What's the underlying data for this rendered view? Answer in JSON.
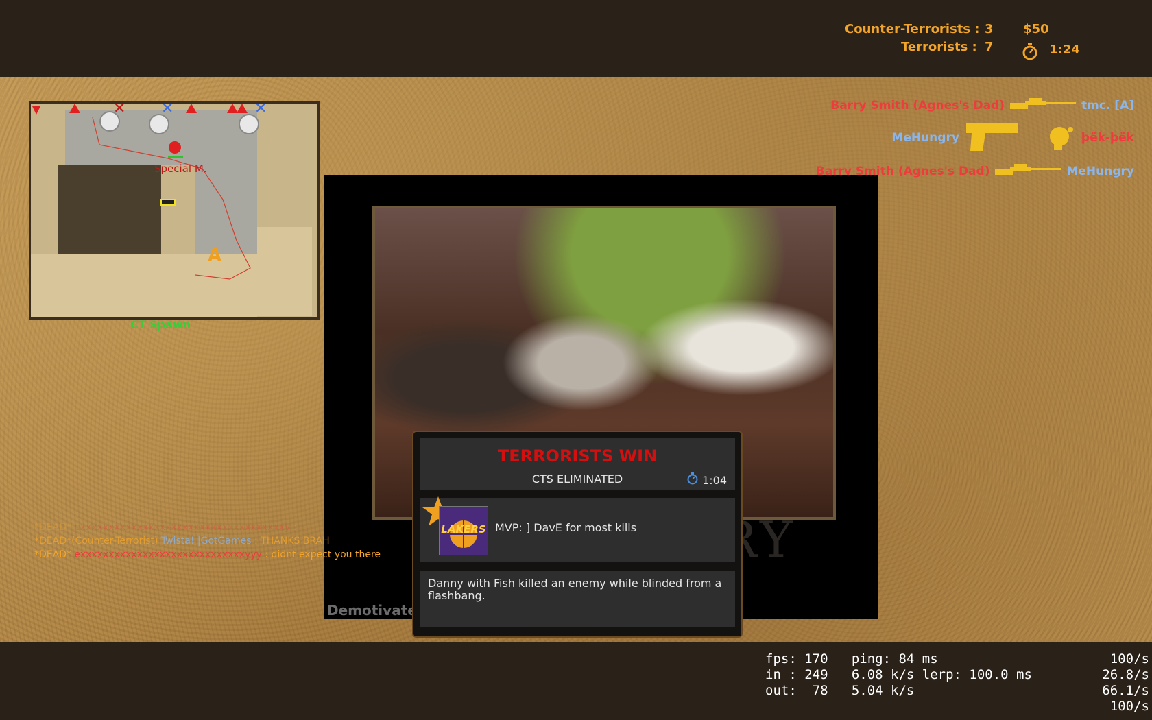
{
  "score": {
    "ct_label": "Counter-Terrorists :",
    "ct_score": "3",
    "t_label": "Terrorists :",
    "t_score": "7",
    "money": "$50",
    "timer": "1:24"
  },
  "killfeed": [
    {
      "killer": "Barry Smith (Agnes's Dad)",
      "killer_team": "t",
      "weapon": "sniper-rifle-icon",
      "victim": "tmc. [A]",
      "victim_team": "ct"
    },
    {
      "killer": "MeHungry",
      "killer_team": "ct",
      "weapon": "pistol-icon",
      "headshot": true,
      "victim": "þëk-þëk",
      "victim_team": "t"
    },
    {
      "killer": "Barry Smith (Agnes's Dad)",
      "killer_team": "t",
      "weapon": "sniper-rifle-icon",
      "victim": "MeHungry",
      "victim_team": "ct"
    }
  ],
  "minimap": {
    "location": "CT Spawn",
    "marker_label": "Special M.",
    "bombsite": "A"
  },
  "poster": {
    "watermark": "DemotivateUs.com",
    "caption": "BRAVERY"
  },
  "round_end": {
    "title": "TERRORISTS WIN",
    "reason": "CTS ELIMINATED",
    "time": "1:04",
    "mvp_text": "MVP: ] DavE for most kills",
    "mvp_avatar": "LAKERS",
    "award_text": "Danny with Fish killed an enemy while blinded from a flashbang."
  },
  "chat": [
    {
      "prefix": "*DEAD*",
      "name": "exxxxxxxxxxxxxxxxxxxxxxxxxxxxxxxxxxxxy",
      "message": ":",
      "faded": true
    },
    {
      "prefix": "*DEAD*(Counter-Terrorist)",
      "name": "Twista! |GotGames",
      "message": ":  THANKS BRAH",
      "faded": true
    },
    {
      "prefix": "*DEAD*",
      "name": "exxxxxxxxxxxxxxxxxxxxxxxxxxxxxyyy",
      "message": ":  didnt expect you there",
      "faded": false
    }
  ],
  "netgraph": {
    "line1": "fps: 170   ping: 84 ms",
    "line2": "in : 249   6.08 k/s lerp: 100.0 ms",
    "line3": "out:  78   5.04 k/s",
    "right": [
      "100/s",
      "26.8/s",
      "66.1/s",
      "100/s"
    ]
  },
  "colors": {
    "hud_orange": "#f2a52a",
    "t_red": "#ee3b3b",
    "ct_blue": "#8ab6ec",
    "win_red": "#d40f0f",
    "location_green": "#3bcc3b"
  }
}
